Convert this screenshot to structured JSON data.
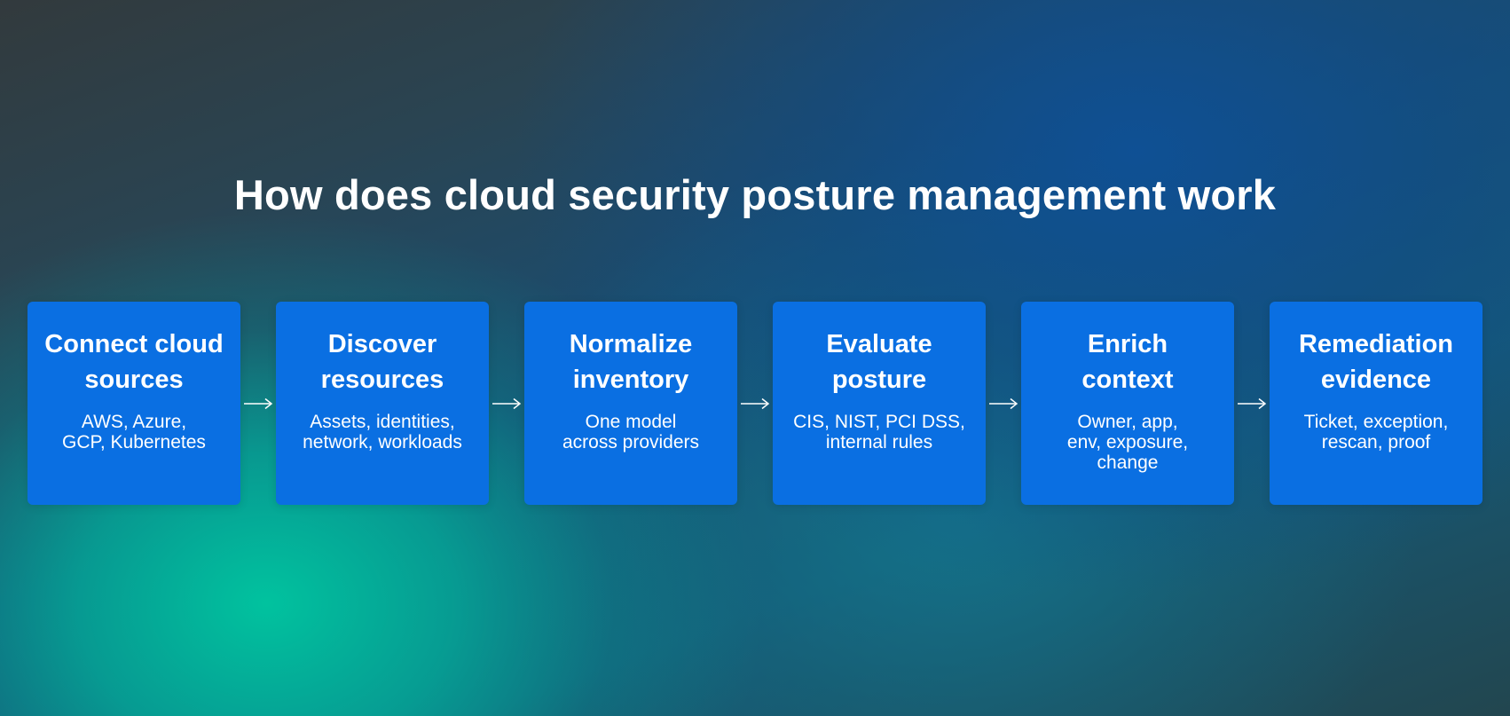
{
  "title": "How does cloud security posture management work",
  "steps": [
    {
      "title": "Connect cloud\nsources",
      "desc": "AWS, Azure,\nGCP, Kubernetes"
    },
    {
      "title": "Discover\nresources",
      "desc": "Assets, identities,\nnetwork, workloads"
    },
    {
      "title": "Normalize\ninventory",
      "desc": "One model\nacross providers"
    },
    {
      "title": "Evaluate\nposture",
      "desc": "CIS, NIST, PCI DSS,\ninternal rules"
    },
    {
      "title": "Enrich\ncontext",
      "desc": "Owner, app,\nenv, exposure,\nchange"
    },
    {
      "title": "Remediation\nevidence",
      "desc": "Ticket, exception,\nrescan, proof"
    }
  ],
  "colors": {
    "card": "#0a6fe2",
    "text": "#ffffff",
    "arrow": "#ffffff"
  },
  "icons": {
    "connector": "arrow-right-icon"
  }
}
